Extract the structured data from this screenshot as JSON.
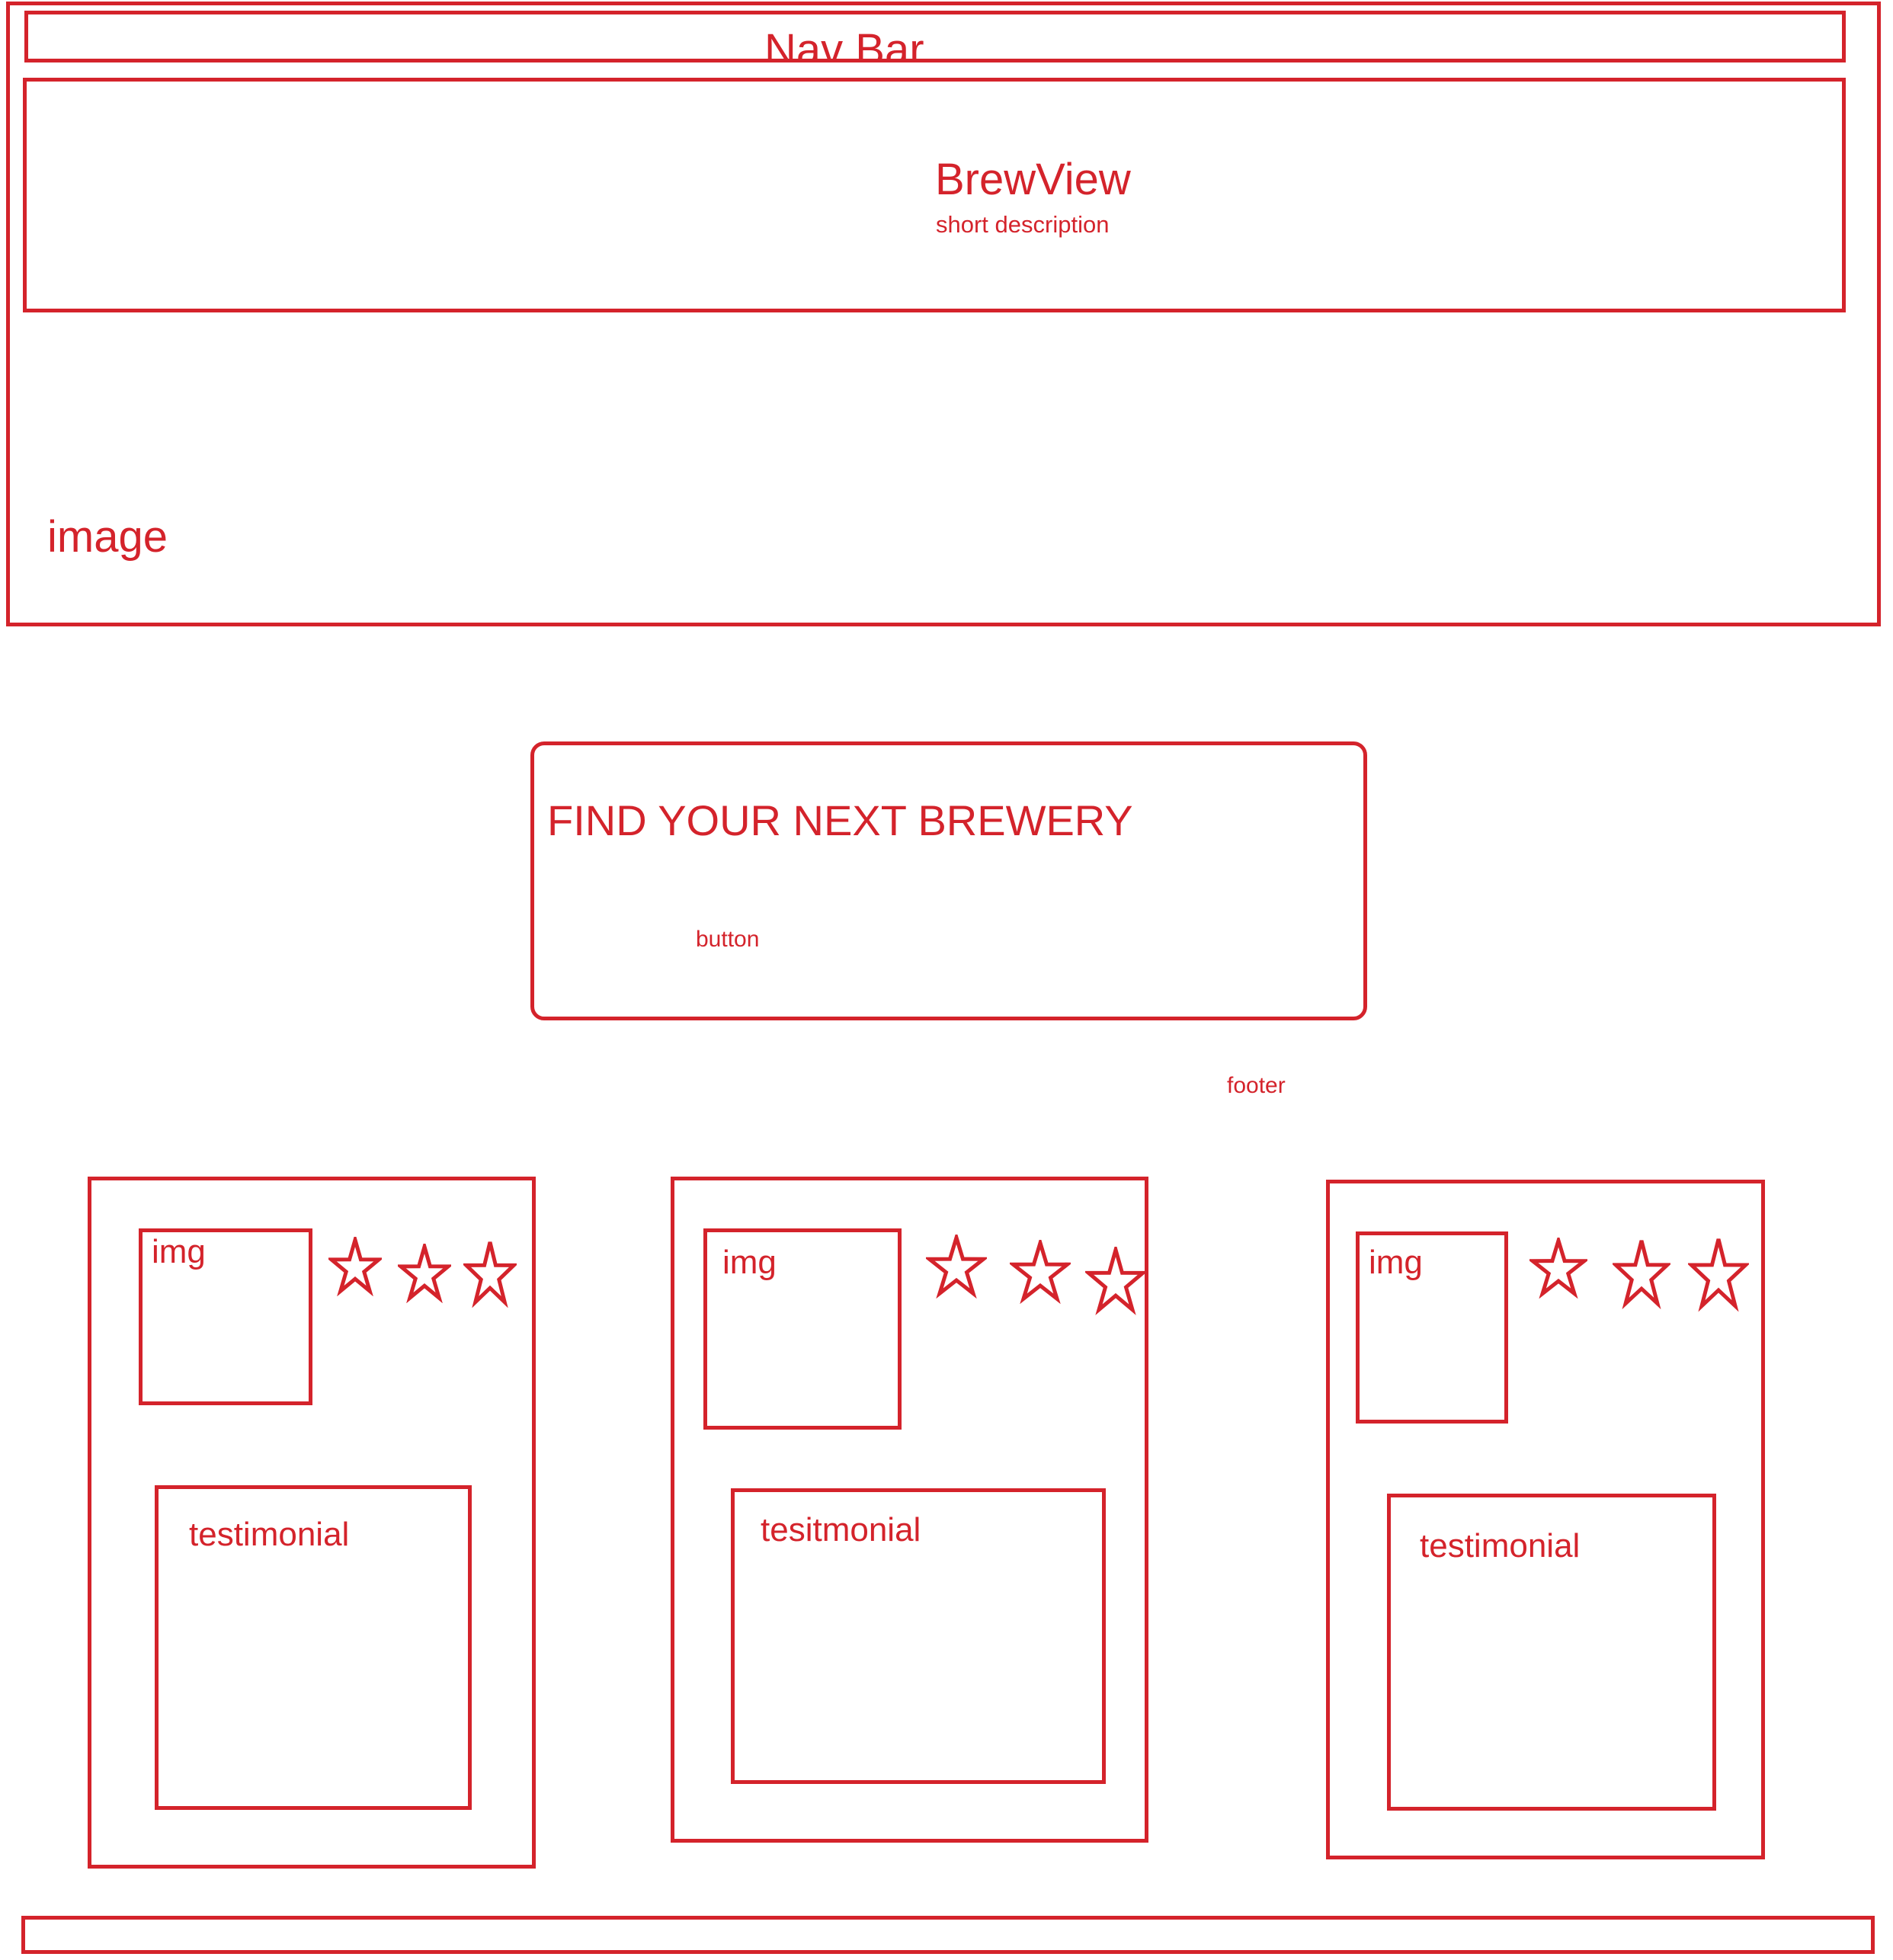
{
  "colors": {
    "stroke": "#d4232b",
    "background": "#ffffff"
  },
  "hero": {
    "nav_label": "Nav Bar",
    "title": "BrewView",
    "subtitle": "short description",
    "image_label": "image"
  },
  "cta": {
    "heading": "FIND YOUR NEXT BREWERY",
    "button_label": "button"
  },
  "footer_label": "footer",
  "cards": [
    {
      "img_label": "img",
      "stars": 3,
      "text_label": "testimonial"
    },
    {
      "img_label": "img",
      "stars": 3,
      "text_label": "tesitmonial"
    },
    {
      "img_label": "img",
      "stars": 3,
      "text_label": "testimonial"
    }
  ],
  "icons": {
    "rating": "star-outline-icon"
  }
}
